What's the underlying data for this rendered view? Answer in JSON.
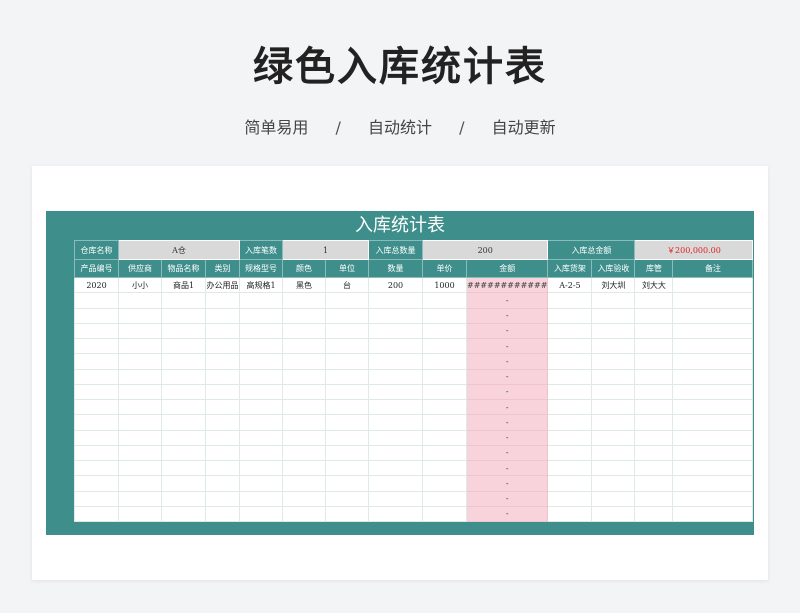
{
  "page": {
    "title": "绿色入库统计表",
    "features": [
      "简单易用",
      "自动统计",
      "自动更新"
    ],
    "separator": "/"
  },
  "sheet": {
    "title": "入库统计表",
    "info": {
      "warehouse_label": "仓库名称",
      "warehouse_value": "A仓",
      "count_label": "入库笔数",
      "count_value": "1",
      "total_qty_label": "入库总数量",
      "total_qty_value": "200",
      "total_amount_label": "入库总金额",
      "total_amount_value": "￥200,000.00"
    },
    "columns": [
      "产品编号",
      "供应商",
      "物品名称",
      "类别",
      "规格型号",
      "颜色",
      "单位",
      "数量",
      "单价",
      "金额",
      "入库货架",
      "入库验收",
      "库管",
      "备注"
    ],
    "rows": [
      [
        "2020",
        "小小",
        "商品1",
        "办公用品",
        "高规格1",
        "黑色",
        "台",
        "200",
        "1000",
        "############",
        "A-2-5",
        "刘大圳",
        "刘大大",
        ""
      ],
      [
        "",
        "",
        "",
        "",
        "",
        "",
        "",
        "",
        "",
        "-",
        "",
        "",
        "",
        ""
      ],
      [
        "",
        "",
        "",
        "",
        "",
        "",
        "",
        "",
        "",
        "-",
        "",
        "",
        "",
        ""
      ],
      [
        "",
        "",
        "",
        "",
        "",
        "",
        "",
        "",
        "",
        "-",
        "",
        "",
        "",
        ""
      ],
      [
        "",
        "",
        "",
        "",
        "",
        "",
        "",
        "",
        "",
        "-",
        "",
        "",
        "",
        ""
      ],
      [
        "",
        "",
        "",
        "",
        "",
        "",
        "",
        "",
        "",
        "-",
        "",
        "",
        "",
        ""
      ],
      [
        "",
        "",
        "",
        "",
        "",
        "",
        "",
        "",
        "",
        "-",
        "",
        "",
        "",
        ""
      ],
      [
        "",
        "",
        "",
        "",
        "",
        "",
        "",
        "",
        "",
        "-",
        "",
        "",
        "",
        ""
      ],
      [
        "",
        "",
        "",
        "",
        "",
        "",
        "",
        "",
        "",
        "-",
        "",
        "",
        "",
        ""
      ],
      [
        "",
        "",
        "",
        "",
        "",
        "",
        "",
        "",
        "",
        "-",
        "",
        "",
        "",
        ""
      ],
      [
        "",
        "",
        "",
        "",
        "",
        "",
        "",
        "",
        "",
        "-",
        "",
        "",
        "",
        ""
      ],
      [
        "",
        "",
        "",
        "",
        "",
        "",
        "",
        "",
        "",
        "-",
        "",
        "",
        "",
        ""
      ],
      [
        "",
        "",
        "",
        "",
        "",
        "",
        "",
        "",
        "",
        "-",
        "",
        "",
        "",
        ""
      ],
      [
        "",
        "",
        "",
        "",
        "",
        "",
        "",
        "",
        "",
        "-",
        "",
        "",
        "",
        ""
      ],
      [
        "",
        "",
        "",
        "",
        "",
        "",
        "",
        "",
        "",
        "-",
        "",
        "",
        "",
        ""
      ],
      [
        "",
        "",
        "",
        "",
        "",
        "",
        "",
        "",
        "",
        "-",
        "",
        "",
        "",
        ""
      ]
    ]
  },
  "colors": {
    "teal": "#3e8e8b",
    "amount_fill": "#f8d3dc",
    "total_amount_text": "#e02020",
    "info_value_fill": "#d9d9d9"
  }
}
